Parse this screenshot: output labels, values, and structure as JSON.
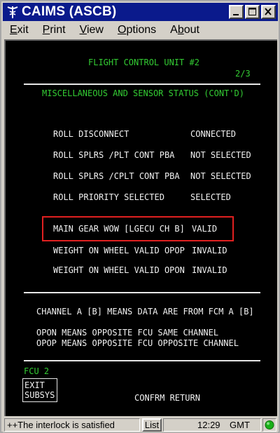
{
  "window": {
    "title": "CAIMS (ASCB)"
  },
  "menu": [
    "Exit",
    "Print",
    "View",
    "Options",
    "About"
  ],
  "screen": {
    "header": "FLIGHT CONTROL UNIT #2",
    "page": "2/3",
    "subtitle": "MISCELLANEOUS AND SENSOR STATUS (CONT'D)",
    "rows": [
      {
        "label": "ROLL DISCONNECT",
        "value": "CONNECTED"
      },
      {
        "label": "ROLL SPLRS /PLT CONT PBA",
        "value": "NOT SELECTED"
      },
      {
        "label": "ROLL SPLRS /CPLT CONT PBA",
        "value": "NOT SELECTED"
      },
      {
        "label": "ROLL PRIORITY SELECTED",
        "value": "SELECTED"
      }
    ],
    "highlight_row": {
      "label": "MAIN GEAR WOW [LGECU CH B]",
      "value": "VALID"
    },
    "rows2": [
      {
        "label": "WEIGHT ON WHEEL VALID OPOP",
        "value": "INVALID"
      },
      {
        "label": "WEIGHT ON WHEEL VALID OPON",
        "value": "INVALID"
      }
    ],
    "notes": [
      "CHANNEL A [B] MEANS DATA ARE FROM FCM A [B]",
      "OPON MEANS OPPOSITE FCU SAME CHANNEL",
      "OPOP MEANS OPPOSITE FCU OPPOSITE CHANNEL"
    ],
    "footer_label": "FCU 2",
    "exit_line1": "EXIT",
    "exit_line2": "SUBSYS",
    "confirm": "CONFRM RETURN"
  },
  "statusbar": {
    "message": "++The interlock is satisfied",
    "list_button": "List",
    "time": "12:29",
    "tz": "GMT",
    "indicator_color": "#19b019"
  },
  "colors": {
    "highlight_border": "#e02020",
    "screen_text_green": "#33cc33",
    "title_bar": "#0a1a8c"
  }
}
